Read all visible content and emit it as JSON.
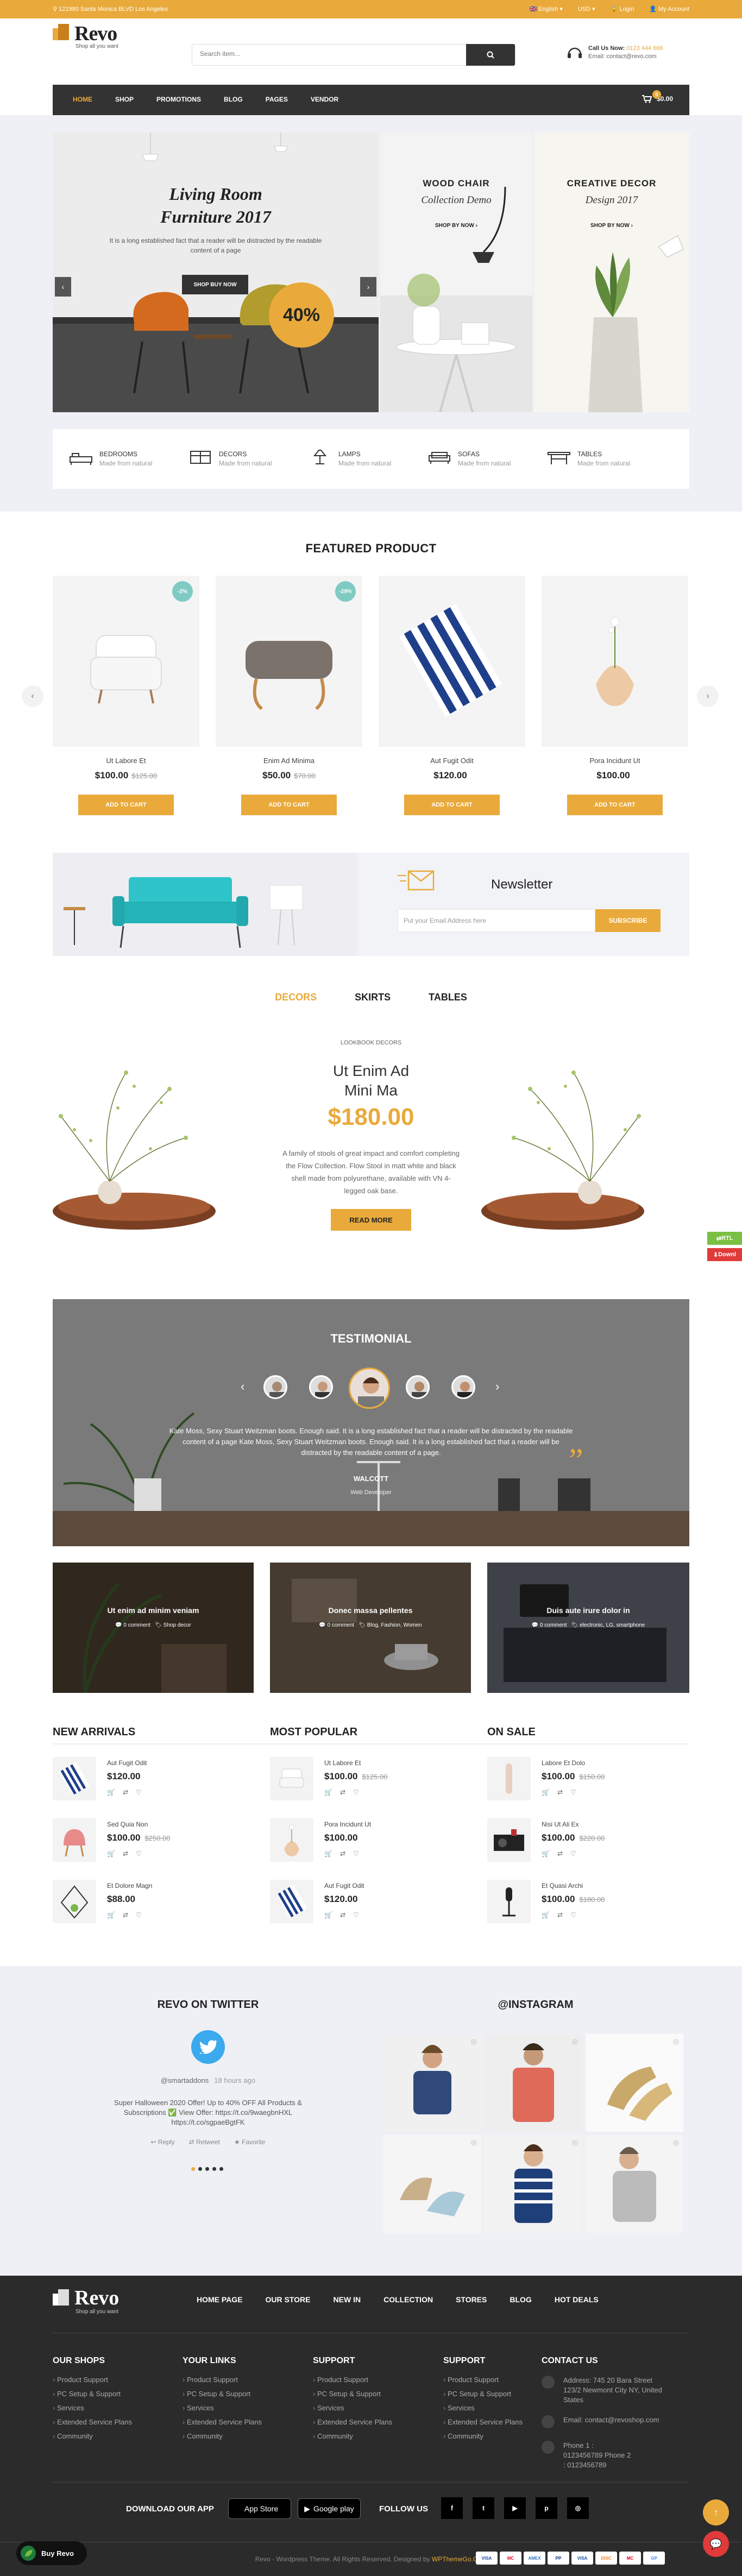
{
  "topbar": {
    "address": "121980 Santa Monica BLVD Los Angeles",
    "language": "English",
    "currency": "USD",
    "login": "Login",
    "account": "My Account"
  },
  "header": {
    "logo_text": "Revo",
    "logo_tagline": "Shop all you want",
    "search_placeholder": "Search item...",
    "call_label": "Call Us Now:",
    "call_phone": "0123 444 666",
    "email_line": "Email: contact@revo.com"
  },
  "nav": {
    "items": [
      "HOME",
      "SHOP",
      "PROMOTIONS",
      "BLOG",
      "PAGES",
      "VENDOR"
    ],
    "cart_count": "0",
    "cart_total": "$0.00"
  },
  "hero": {
    "main_title": "Living Room Furniture 2017",
    "main_desc": "It is a long established fact that a reader will be distracted by the readable content of a page",
    "main_button": "SHOP BUY NOW",
    "discount": "40%",
    "banner2_title": "WOOD CHAIR",
    "banner2_sub": "Collection Demo",
    "banner2_link": "SHOP BY NOW",
    "banner3_title": "CREATIVE DECOR",
    "banner3_sub": "Design 2017",
    "banner3_link": "SHOP BY NOW"
  },
  "categories": [
    {
      "name": "BEDROOMS",
      "sub": "Made from natural",
      "icon": "bed-icon"
    },
    {
      "name": "DECORS",
      "sub": "Made from natural",
      "icon": "decor-icon"
    },
    {
      "name": "LAMPS",
      "sub": "Made from natural",
      "icon": "lamp-icon"
    },
    {
      "name": "SOFAS",
      "sub": "Made from natural",
      "icon": "sofa-icon"
    },
    {
      "name": "TABLES",
      "sub": "Made from natural",
      "icon": "table-icon"
    }
  ],
  "featured": {
    "title": "FEATURED PRODUCT",
    "add_label": "ADD TO CART",
    "products": [
      {
        "name": "Ut Labore Et",
        "price": "$100.00",
        "old": "$125.00",
        "disc": "-2%"
      },
      {
        "name": "Enim Ad Minima",
        "price": "$50.00",
        "old": "$70.00",
        "disc": "-29%"
      },
      {
        "name": "Aut Fugit Odit",
        "price": "$120.00",
        "old": "",
        "disc": ""
      },
      {
        "name": "Pora Incidunt Ut",
        "price": "$100.00",
        "old": "",
        "disc": ""
      }
    ]
  },
  "newsletter": {
    "title": "Newsletter",
    "placeholder": "Put your Email Address here",
    "button": "SUBSCRIBE"
  },
  "lookbook": {
    "tabs": [
      "DECORS",
      "SKIRTS",
      "TABLES"
    ],
    "label": "LOOKBOOK DECORS",
    "title": "Ut Enim Ad Mini Ma",
    "price": "$180.00",
    "desc": "A family of stools of great impact and comfort completing the Flow Collection. Flow Stool in matt white and black shell made from polyurethane, available with VN 4-legged oak base.",
    "button": "READ MORE"
  },
  "side_buttons": {
    "rtl": "RTL",
    "download": "Downl"
  },
  "testimonial": {
    "title": "TESTIMONIAL",
    "quote": "Kate Moss, Sexy Stuart Weitzman boots. Enough said. It is a long established fact that a reader will be distracted by the readable content of a page Kate Moss, Sexy Stuart Weitzman boots. Enough said. It is a long established fact that a reader will be distracted by the readable content of a page.",
    "name": "WALCOTT",
    "role": "Web Developer"
  },
  "blogs": [
    {
      "title": "Ut enim ad minim veniam",
      "comments": "0 comment",
      "tags": "Shop decor"
    },
    {
      "title": "Donec massa pellentes",
      "comments": "0 comment",
      "tags": "Blog, Fashion, Women"
    },
    {
      "title": "Duis aute irure dolor in",
      "comments": "0 comment",
      "tags": "electronic, LG, smartphone"
    }
  ],
  "lists": {
    "new_arrivals": {
      "title": "NEW ARRIVALS",
      "items": [
        {
          "name": "Aut Fugit Odit",
          "price": "$120.00",
          "old": ""
        },
        {
          "name": "Sed Quia Non",
          "price": "$100.00",
          "old": "$250.00"
        },
        {
          "name": "Et Dolore Magn",
          "price": "$88.00",
          "old": ""
        }
      ]
    },
    "most_popular": {
      "title": "MOST POPULAR",
      "items": [
        {
          "name": "Ut Labore Et",
          "price": "$100.00",
          "old": "$125.00"
        },
        {
          "name": "Pora Incidunt Ut",
          "price": "$100.00",
          "old": ""
        },
        {
          "name": "Aut Fugit Odit",
          "price": "$120.00",
          "old": ""
        }
      ]
    },
    "on_sale": {
      "title": "ON SALE",
      "items": [
        {
          "name": "Labore Et Dolo",
          "price": "$100.00",
          "old": "$150.00"
        },
        {
          "name": "Nisi Ut Ali Ex",
          "price": "$100.00",
          "old": "$220.00"
        },
        {
          "name": "Et Quasi Archi",
          "price": "$100.00",
          "old": "$180.00"
        }
      ]
    }
  },
  "twitter": {
    "title": "REVO ON TWITTER",
    "user": "@smartaddons",
    "time": "18 hours ago",
    "text": "Super Halloween 2020 Offer! Up to 40% OFF All Products & Subscriptions ✅ View Offer: https://t.co/9waegbnHXL https://t.co/sgpaeBgtFK",
    "reply": "Reply",
    "retweet": "Retweet",
    "favorite": "Favorite"
  },
  "instagram": {
    "title": "@INSTAGRAM"
  },
  "footer": {
    "logo_text": "Revo",
    "logo_tagline": "Shop all you want",
    "nav": [
      "HOME PAGE",
      "OUR STORE",
      "NEW IN",
      "COLLECTION",
      "STORES",
      "BLOG",
      "HOT DEALS"
    ],
    "our_shops": {
      "title": "OUR SHOPS",
      "items": [
        "Product Support",
        "PC Setup & Support",
        "Services",
        "Extended Service Plans",
        "Community"
      ]
    },
    "your_links": {
      "title": "YOUR LINKS",
      "items": [
        "Product Support",
        "PC Setup & Support",
        "Services",
        "Extended Service Plans",
        "Community"
      ]
    },
    "support1": {
      "title": "SUPPORT",
      "items": [
        "Product Support",
        "PC Setup & Support",
        "Services",
        "Extended Service Plans",
        "Community"
      ]
    },
    "support2": {
      "title": "SUPPORT",
      "items": [
        "Product Support",
        "PC Setup & Support",
        "Services",
        "Extended Service Plans",
        "Community"
      ]
    },
    "contact": {
      "title": "CONTACT US",
      "address": "Address: 745 20 Bara Street 123/2 Newmont City NY, United States",
      "email": "Email: contact@revoshop.com",
      "phone": "Phone 1 : 0123456789 Phone 2 : 0123456789"
    },
    "download": "DOWNLOAD OUR APP",
    "app_store": "App Store",
    "google_play": "Google play",
    "follow": "FOLLOW US",
    "copyright_pre": "Revo - Wordpress Theme. All Rights Reserved. Designed by ",
    "copyright_link": "WPThemeGo.Com",
    "buy": "Buy Revo",
    "payments": [
      "VISA",
      "MC",
      "AMEX",
      "PP",
      "VISA",
      "DISC",
      "MC",
      "GP"
    ]
  },
  "colors": {
    "accent": "#e9aa3b",
    "dark": "#333333"
  }
}
